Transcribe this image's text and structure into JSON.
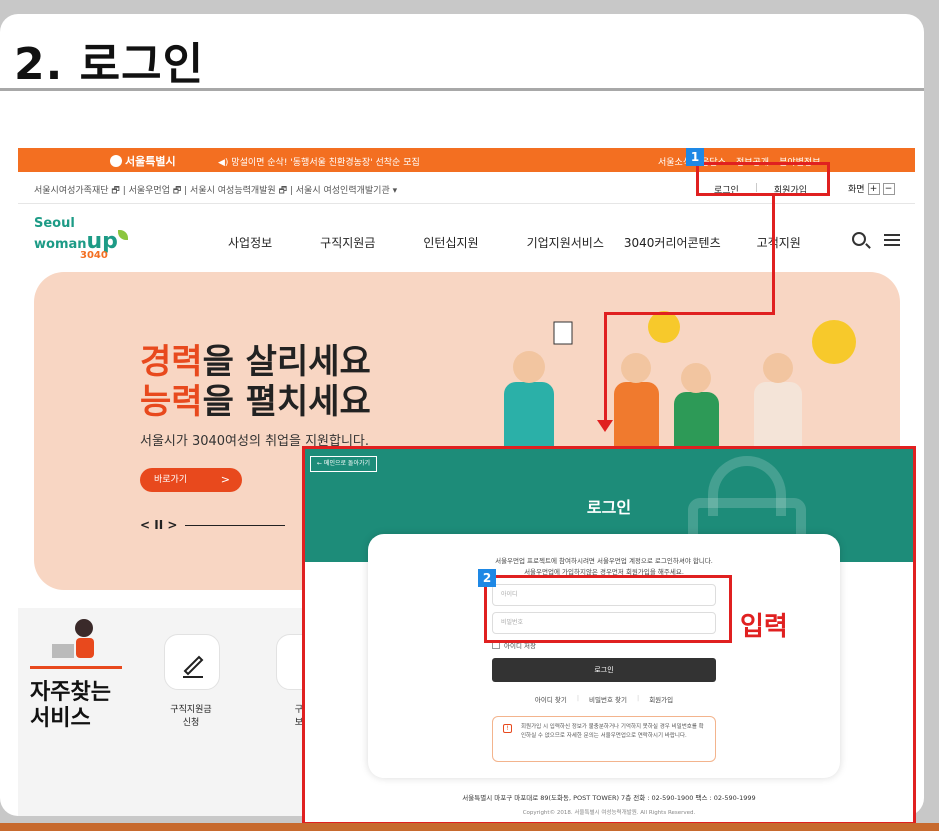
{
  "slide": {
    "title": "2. 로그인"
  },
  "site": {
    "topbar": {
      "city": "서울특별시",
      "notice": "◀) 망설이면 순삭! '동행서울 친환경농장' 선착순 모집",
      "links": [
        "서울소식",
        "응답소",
        "정보공개",
        "분야별정보"
      ]
    },
    "utilbar": {
      "family_sites": "서울시여성가족재단 🗗 | 서울우먼업 🗗 | 서울시 여성능력개발원 🗗 | 서울시 여성인력개발기관 ▾",
      "login": "로그인",
      "signup": "회원가입",
      "screen_label": "화면",
      "zoom_in": "+",
      "zoom_out": "−"
    },
    "brand": {
      "line1": "Seoul",
      "line2": "woman",
      "up": "up",
      "year": "3040"
    },
    "nav": [
      "사업정보",
      "구직지원금",
      "인턴십지원",
      "기업지원서비스",
      "3040커리어콘텐츠",
      "고객지원"
    ],
    "hero": {
      "highlight1": "경력",
      "line1_rest": "을 살리세요",
      "highlight2": "능력",
      "line2_rest": "을 펼치세요",
      "sub": "서울시가 3040여성의 취업을 지원합니다.",
      "cta": "바로가기",
      "cta_arrow": ">",
      "ctrl": "< II >"
    },
    "quick": {
      "title_line1": "자주찾는",
      "title_line2": "서비스",
      "items": [
        {
          "label_line1": "구직지원금",
          "label_line2": "신청"
        },
        {
          "label_line1": "구직",
          "label_line2": "보고"
        }
      ]
    }
  },
  "login": {
    "back": "← 메인으로 돌아가기",
    "title": "로그인",
    "intro_line1": "서울우먼업 프로젝트에 참여하시려면 서울우먼업 계정으로 로그인하셔야 합니다.",
    "intro_line2": "서울우먼업에 가입하지않은 경우먼저 회원가입을 해주세요.",
    "id_placeholder": "아이디",
    "pw_placeholder": "비밀번호",
    "remember": "아이디 저장",
    "submit": "로그인",
    "find_id": "아이디 찾기",
    "find_pw": "비밀번호 찾기",
    "signup": "회원가입",
    "notice_icon": "!",
    "notice": "회원가입 시 입력하신 정보가 불충분하거나 기억하지 못하실 경우 비밀번호를 확인하실 수 없으므로 자세한 문의는 서울우먼업으로 연락하시기 바랍니다.",
    "footer": "서울특별시 마포구 마포대로 89(도화동, POST TOWER) 7층   전화 : 02-590-1900   팩스 : 02-590-1999",
    "copyright": "Copyright© 2018. 서울특별시 여성능력개발원. All Rights Reserved."
  },
  "annotations": {
    "step1": "1",
    "step2": "2",
    "input_label": "입력"
  },
  "colors": {
    "accent": "#f36f21",
    "login_band": "#1d8c79",
    "annotation": "#e02020",
    "step_badge": "#1e88e5"
  }
}
